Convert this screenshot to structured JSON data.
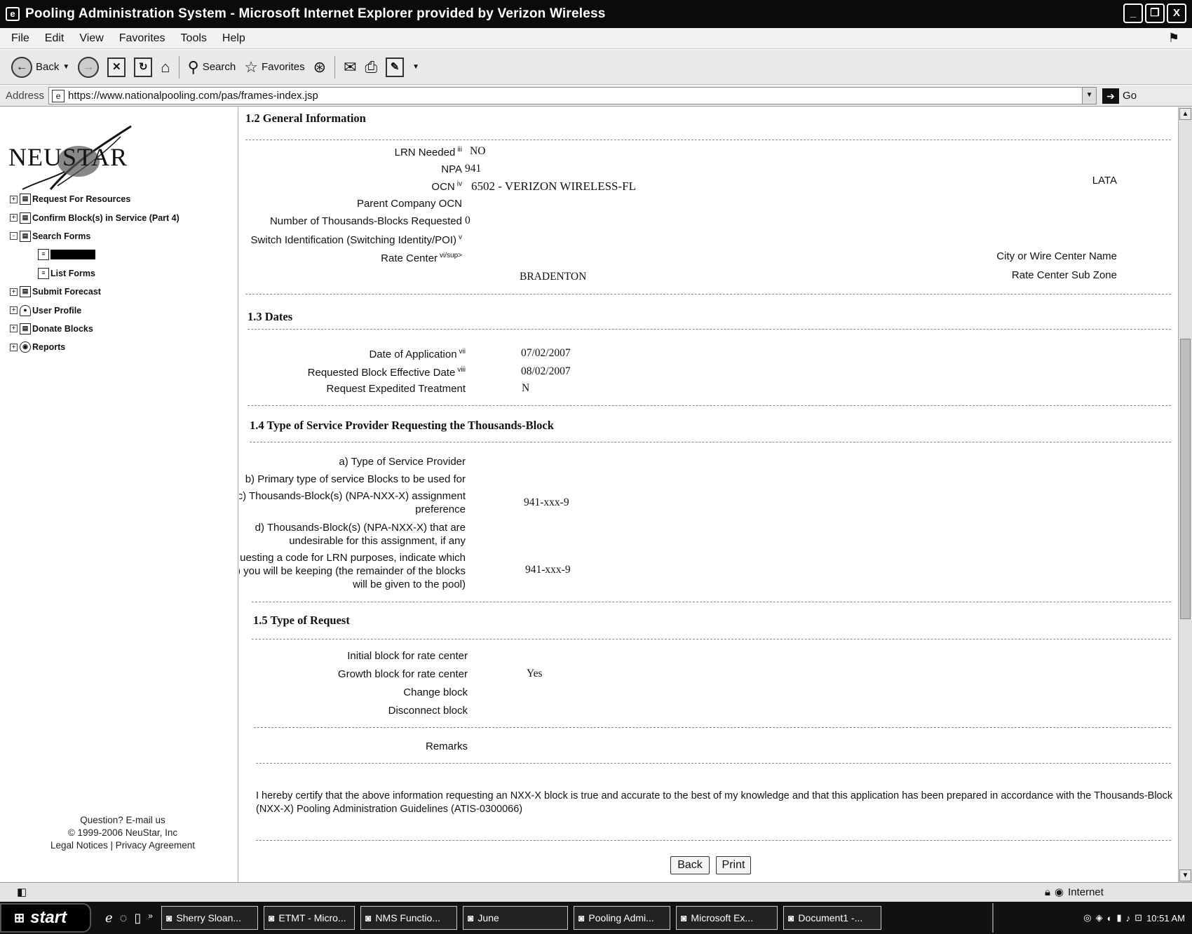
{
  "window": {
    "title": "Pooling Administration System - Microsoft Internet Explorer provided by Verizon Wireless",
    "buttons": [
      "_",
      "❐",
      "X"
    ]
  },
  "menu": [
    "File",
    "Edit",
    "View",
    "Favorites",
    "Tools",
    "Help"
  ],
  "toolbar": {
    "back_label": "Back",
    "search_label": "Search",
    "favorites_label": "Favorites"
  },
  "address": {
    "label": "Address",
    "url": "https://www.nationalpooling.com/pas/frames-index.jsp",
    "go_label": "Go"
  },
  "sidebar": {
    "logo_text": "NEUSTAR",
    "nav": [
      {
        "label": "Request For Resources",
        "expander": "+"
      },
      {
        "label": "Confirm Block(s) in Service (Part 4)",
        "expander": "+"
      },
      {
        "label": "Search Forms",
        "expander": "-"
      },
      {
        "label": "",
        "selected": true
      },
      {
        "label": "List Forms"
      },
      {
        "label": "Submit Forecast",
        "expander": "+"
      },
      {
        "label": "User Profile",
        "expander": "+"
      },
      {
        "label": "Donate Blocks",
        "expander": "+"
      },
      {
        "label": "Reports",
        "expander": "+"
      }
    ],
    "footer": {
      "question": "Question? E-mail us",
      "copyright": "© 1999-2006 NeuStar, Inc",
      "legal": "Legal Notices | Privacy Agreement"
    }
  },
  "form": {
    "general": {
      "title": "1.2 General Information",
      "lrn_label": "LRN Needed",
      "lrn_sup": "iii",
      "lrn_value": "NO",
      "npa_label": "NPA",
      "npa_value": "941",
      "lata_label": "LATA",
      "ocn_label": "OCN",
      "ocn_sup": "iv",
      "ocn_value": "6502 - VERIZON WIRELESS-FL",
      "parent_ocn_label": "Parent Company OCN",
      "num_blocks_label": "Number of Thousands-Blocks Requested",
      "num_blocks_value": "0",
      "switch_label": "Switch Identification (Switching Identity/POI)",
      "switch_sup": "v",
      "city_label": "City or Wire Center Name",
      "rate_center_label": "Rate Center",
      "rate_center_sup": "vi/sup>",
      "rate_center_value": "BRADENTON",
      "rate_sub_zone_label": "Rate Center Sub Zone"
    },
    "dates": {
      "title": "1.3 Dates",
      "app_date_label": "Date of Application",
      "app_date_sup": "vii",
      "app_date_value": "07/02/2007",
      "eff_date_label": "Requested Block Effective Date",
      "eff_date_sup": "viii",
      "eff_date_value": "08/02/2007",
      "expedite_label": "Request Expedited Treatment",
      "expedite_value": "N"
    },
    "provider": {
      "title": "1.4 Type of Service Provider Requesting the Thousands-Block",
      "a_label": "a) Type of Service Provider",
      "b_label": "b) Primary type of service Blocks to be used for",
      "c_label": "c) Thousands-Block(s) (NPA-NXX-X) assignment preference",
      "c_value": "941-xxx-9",
      "d_label": "d) Thousands-Block(s) (NPA-NXX-X) that are undesirable for this assignment, if any",
      "e_label": "e) If requesting a code for LRN purposes, indicate which block(s) you will be keeping (the remainder of the blocks will be given to the pool)",
      "e_value": "941-xxx-9"
    },
    "request": {
      "title": "1.5 Type of Request",
      "initial_label": "Initial block for rate center",
      "growth_label": "Growth block for rate center",
      "growth_value": "Yes",
      "change_label": "Change block",
      "disconnect_label": "Disconnect block"
    },
    "remarks_label": "Remarks",
    "certification": "I hereby certify that the above information requesting an NXX-X block is true and accurate to the best of my knowledge and that this application has been prepared in accordance with the Thousands-Block (NXX-X) Pooling Administration Guidelines (ATIS-0300066)",
    "back_button": "Back",
    "print_button": "Print"
  },
  "status": {
    "zone": "Internet"
  },
  "taskbar": {
    "start": "start",
    "tasks": [
      "Sherry Sloan...",
      "ETMT - Micro...",
      "NMS Functio...",
      "June",
      "Pooling Admi...",
      "Microsoft Ex...",
      "Document1 -..."
    ],
    "clock": "10:51 AM"
  }
}
